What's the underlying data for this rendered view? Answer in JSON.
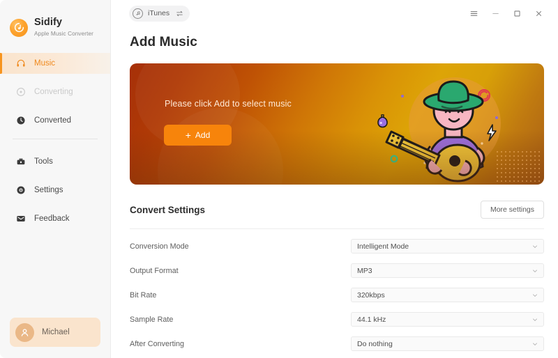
{
  "brand": {
    "name": "Sidify",
    "tagline": "Apple Music Converter",
    "logo_icon": "sidify-logo-icon",
    "accent": "#f7941e"
  },
  "sidebar": {
    "items": [
      {
        "label": "Music",
        "icon": "headphones-icon",
        "state": "active"
      },
      {
        "label": "Converting",
        "icon": "converting-icon",
        "state": "disabled"
      },
      {
        "label": "Converted",
        "icon": "clock-icon",
        "state": "normal"
      },
      {
        "label": "Tools",
        "icon": "toolbox-icon",
        "state": "normal"
      },
      {
        "label": "Settings",
        "icon": "gear-icon",
        "state": "normal"
      },
      {
        "label": "Feedback",
        "icon": "envelope-icon",
        "state": "normal"
      }
    ],
    "profile": {
      "name": "Michael",
      "avatar_icon": "user-avatar-icon"
    }
  },
  "titlebar": {
    "source": {
      "label": "iTunes",
      "icon": "music-note-icon",
      "switch_icon": "swap-arrows-icon"
    },
    "controls": [
      {
        "name": "menu",
        "icon": "hamburger-menu-icon"
      },
      {
        "name": "minimize",
        "icon": "minimize-icon"
      },
      {
        "name": "maximize",
        "icon": "maximize-icon"
      },
      {
        "name": "close",
        "icon": "close-icon"
      }
    ]
  },
  "main": {
    "page_title": "Add Music",
    "banner": {
      "message": "Please click Add to select music",
      "add_label": "Add",
      "add_icon": "plus-icon",
      "illustration": "guitarist-illustration",
      "gradient_from": "#a63008",
      "gradient_to": "#dda407",
      "button_color": "#f7840b"
    },
    "convert_settings": {
      "title": "Convert Settings",
      "more_button": "More settings",
      "rows": [
        {
          "label": "Conversion Mode",
          "value": "Intelligent Mode",
          "icon": "chevron-down-icon"
        },
        {
          "label": "Output Format",
          "value": "MP3",
          "icon": "chevron-down-icon"
        },
        {
          "label": "Bit Rate",
          "value": "320kbps",
          "icon": "chevron-down-icon"
        },
        {
          "label": "Sample Rate",
          "value": "44.1 kHz",
          "icon": "chevron-down-icon"
        },
        {
          "label": "After Converting",
          "value": "Do nothing",
          "icon": "chevron-down-icon"
        }
      ]
    }
  }
}
